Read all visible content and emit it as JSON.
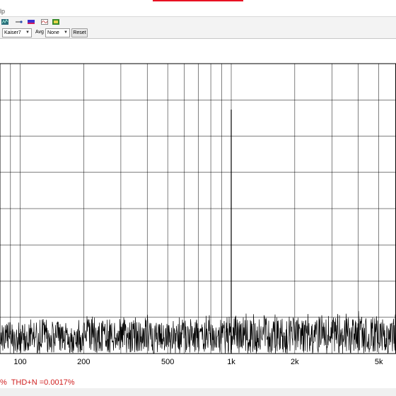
{
  "menubar": {
    "partial_label": "lp"
  },
  "toolbar": {
    "icons": [
      "spectrum-icon",
      "probe-icon",
      "color-bar-icon",
      "waveform-icon",
      "export-icon"
    ]
  },
  "controls": {
    "window_value": "Kaiser7",
    "avg_label": "Avg",
    "avg_value": "None",
    "reset_label": "Reset"
  },
  "chart_data": {
    "type": "line",
    "x_scale": "log",
    "xlim": [
      70,
      7000
    ],
    "x_ticks": [
      {
        "value": 100,
        "label": "100"
      },
      {
        "value": 200,
        "label": "200"
      },
      {
        "value": 500,
        "label": "500"
      },
      {
        "value": 1000,
        "label": "1k"
      },
      {
        "value": 2000,
        "label": "2k"
      },
      {
        "value": 5000,
        "label": "5k"
      }
    ],
    "grid": true,
    "series": [
      {
        "description": "noise floor spectrum with a single tone at 1 kHz",
        "fundamental_hz": 1000
      }
    ]
  },
  "status": {
    "partial_percent": "%",
    "thd_text": "THD+N =0.0017%"
  }
}
